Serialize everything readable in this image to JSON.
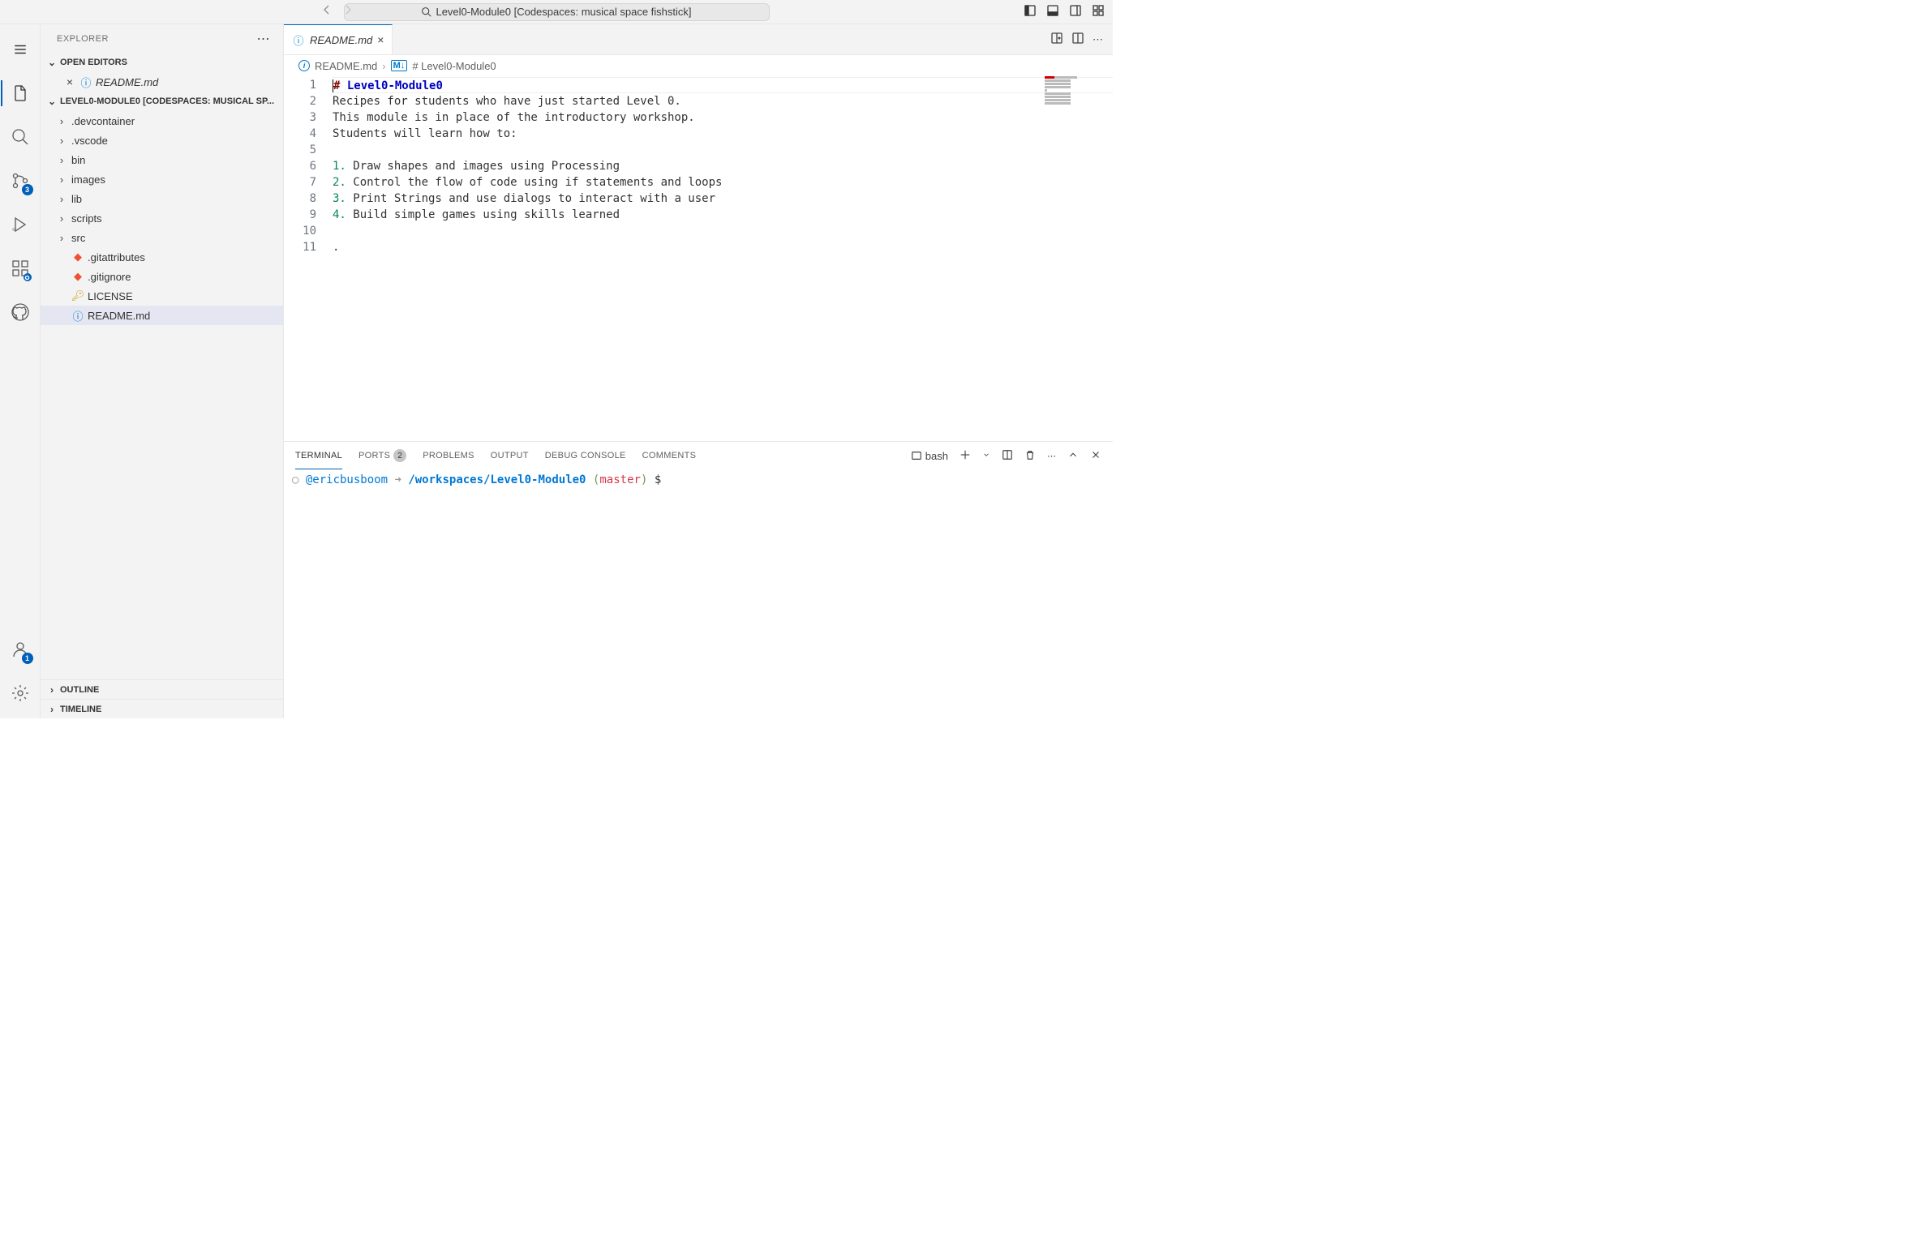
{
  "titlebar": {
    "search": "Level0-Module0 [Codespaces: musical space fishstick]"
  },
  "activity": {
    "scm_badge": "3",
    "accounts_badge": "1"
  },
  "sidebar": {
    "title": "EXPLORER",
    "open_editors": {
      "label": "OPEN EDITORS",
      "items": [
        {
          "name": "README.md"
        }
      ]
    },
    "folder": {
      "label": "LEVEL0-MODULE0 [CODESPACES: MUSICAL SP...",
      "items": [
        {
          "type": "folder",
          "name": ".devcontainer"
        },
        {
          "type": "folder",
          "name": ".vscode"
        },
        {
          "type": "folder",
          "name": "bin"
        },
        {
          "type": "folder",
          "name": "images"
        },
        {
          "type": "folder",
          "name": "lib"
        },
        {
          "type": "folder",
          "name": "scripts"
        },
        {
          "type": "folder",
          "name": "src"
        },
        {
          "type": "file",
          "name": ".gitattributes",
          "icon": "git"
        },
        {
          "type": "file",
          "name": ".gitignore",
          "icon": "git"
        },
        {
          "type": "file",
          "name": "LICENSE",
          "icon": "key"
        },
        {
          "type": "file",
          "name": "README.md",
          "icon": "info",
          "selected": true
        }
      ]
    },
    "outline": "OUTLINE",
    "timeline": "TIMELINE"
  },
  "tabs": {
    "active": "README.md"
  },
  "breadcrumbs": {
    "file": "README.md",
    "heading": "# Level0-Module0"
  },
  "editor": {
    "lines": [
      {
        "n": "1",
        "type": "heading",
        "hash": "#",
        "text": " Level0-Module0"
      },
      {
        "n": "2",
        "type": "text",
        "text": "Recipes for students who have just started Level 0."
      },
      {
        "n": "3",
        "type": "text",
        "text": "This module is in place of the introductory workshop."
      },
      {
        "n": "4",
        "type": "text",
        "text": "Students will learn how to:"
      },
      {
        "n": "5",
        "type": "text",
        "text": ""
      },
      {
        "n": "6",
        "type": "list",
        "num": "1.",
        "text": " Draw shapes and images using Processing"
      },
      {
        "n": "7",
        "type": "list",
        "num": "2.",
        "text": " Control the flow of code using if statements and loops"
      },
      {
        "n": "8",
        "type": "list",
        "num": "3.",
        "text": " Print Strings and use dialogs to interact with a user"
      },
      {
        "n": "9",
        "type": "list",
        "num": "4.",
        "text": " Build simple games using skills learned"
      },
      {
        "n": "10",
        "type": "text",
        "text": ""
      },
      {
        "n": "11",
        "type": "text",
        "text": "."
      }
    ]
  },
  "panel": {
    "tabs": {
      "terminal": "TERMINAL",
      "ports": "PORTS",
      "ports_badge": "2",
      "problems": "PROBLEMS",
      "output": "OUTPUT",
      "debug": "DEBUG CONSOLE",
      "comments": "COMMENTS"
    },
    "shell": "bash",
    "prompt": {
      "user": "@ericbusboom",
      "arrow": "➜",
      "path": "/workspaces/Level0-Module0",
      "branch": "master",
      "symbol": "$"
    }
  }
}
